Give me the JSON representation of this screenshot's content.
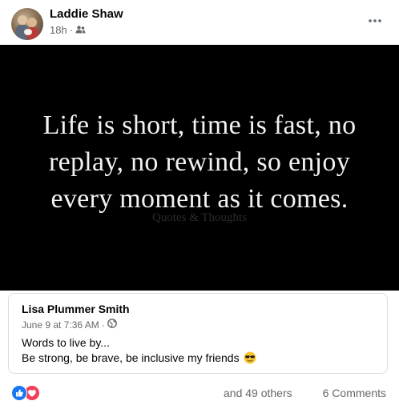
{
  "post": {
    "author": "Laddie Shaw",
    "time": "18h",
    "separator": "·",
    "audience_icon": "friends-icon",
    "more_icon": "more-options-icon"
  },
  "image": {
    "quote": "Life is short, time is fast, no replay, no rewind, so enjoy every moment as it comes.",
    "quote_lines": [
      "Life is short, time is fast, no",
      "replay, no rewind, so enjoy",
      "every moment as it comes."
    ],
    "watermark": "Quotes & Thoughts"
  },
  "shared": {
    "author": "Lisa Plummer Smith",
    "date": "June 9 at 7:36 AM",
    "separator": "·",
    "audience_icon": "globe-icon",
    "text_line1": "Words to live by...",
    "text_line2": "Be strong, be brave, be inclusive my friends",
    "emoji": "sunglasses-emoji"
  },
  "footer": {
    "reactions": [
      "like",
      "love"
    ],
    "others": "and 49 others",
    "comments": "6 Comments"
  },
  "colors": {
    "like": "#1877f2",
    "love": "#f33e58",
    "secondary_text": "#65676b"
  }
}
